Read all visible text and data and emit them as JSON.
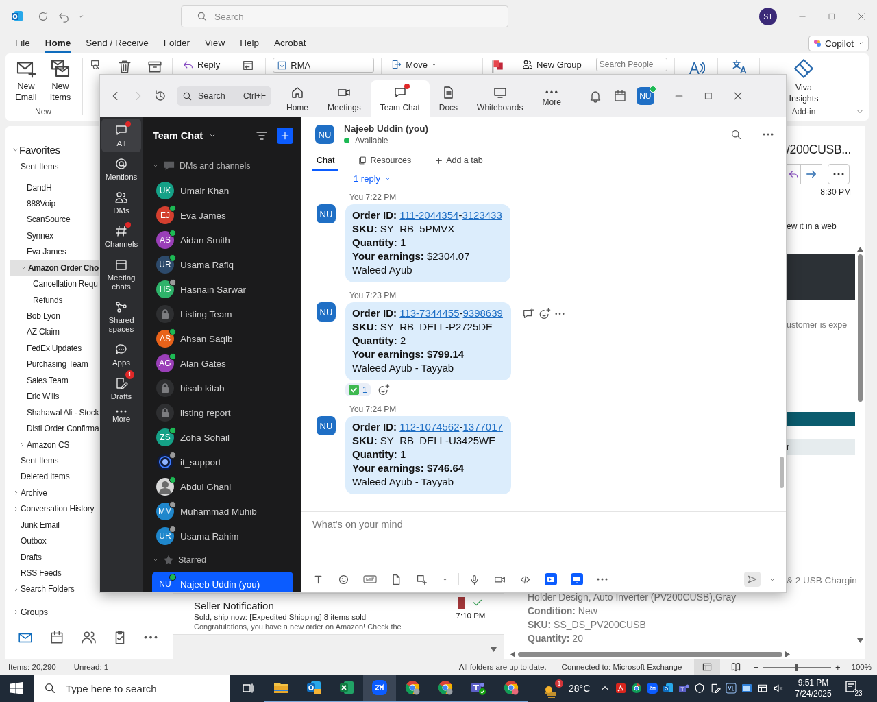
{
  "outlook": {
    "search_placeholder": "Search",
    "account_initials": "ST",
    "menu_tabs": [
      {
        "label": "File",
        "selected": false
      },
      {
        "label": "Home",
        "selected": true
      },
      {
        "label": "Send / Receive",
        "selected": false
      },
      {
        "label": "Folder",
        "selected": false
      },
      {
        "label": "View",
        "selected": false
      },
      {
        "label": "Help",
        "selected": false
      },
      {
        "label": "Acrobat",
        "selected": false
      }
    ],
    "copilot": "Copilot",
    "ribbon": {
      "new_email": "New Email",
      "new_items": "New Items",
      "new_group_label": "New",
      "reply": "Reply",
      "quick_step": "RMA",
      "move": "Move",
      "new_group": "New Group",
      "search_people_placeholder": "Search People",
      "viva": "Viva Insights",
      "addin_label": "Add-in"
    },
    "favorites": {
      "label": "Favorites",
      "expanded": true,
      "items": [
        {
          "label": "Sent Items",
          "selected": false
        }
      ]
    },
    "inbox_folders": [
      {
        "label": "DandH",
        "selected": false
      },
      {
        "label": "888Voip",
        "selected": false
      },
      {
        "label": "ScanSource",
        "selected": false
      },
      {
        "label": "Synnex",
        "selected": false
      },
      {
        "label": "Eva James",
        "selected": false
      },
      {
        "label": "Amazon Order Cho",
        "selected": true,
        "expanded": true,
        "children": [
          {
            "label": "Cancellation Requ",
            "selected": false
          },
          {
            "label": "Refunds",
            "selected": false
          }
        ]
      },
      {
        "label": "Bob Lyon",
        "selected": false
      },
      {
        "label": "AZ Claim",
        "selected": false
      },
      {
        "label": "FedEx Updates",
        "selected": false
      },
      {
        "label": "Purchasing Team",
        "selected": false
      },
      {
        "label": "Sales Team",
        "selected": false
      },
      {
        "label": "Eric Wills",
        "selected": false
      },
      {
        "label": "Shahawal Ali - Stock",
        "selected": false
      },
      {
        "label": "Disti Order Confirma",
        "selected": false
      },
      {
        "label": "Amazon CS",
        "selected": false,
        "expanded": false
      }
    ],
    "mailbox_folders": [
      {
        "label": "Sent Items",
        "selected": false
      },
      {
        "label": "Deleted Items",
        "selected": false
      },
      {
        "label": "Archive",
        "selected": false,
        "expanded": false
      },
      {
        "label": "Conversation History",
        "selected": false,
        "expanded": false
      },
      {
        "label": "Junk Email",
        "selected": false
      },
      {
        "label": "Outbox",
        "selected": false
      },
      {
        "label": "Drafts",
        "selected": false
      },
      {
        "label": "RSS Feeds",
        "selected": false
      },
      {
        "label": "Search Folders",
        "selected": false,
        "expanded": false
      }
    ],
    "groups": {
      "label": "Groups",
      "expanded": false
    },
    "nav": [
      {
        "selected": true
      },
      {
        "selected": false
      },
      {
        "selected": false
      },
      {
        "selected": false
      },
      {
        "selected": false
      }
    ],
    "message": {
      "sender": "Seller Notification",
      "subject": "Sold, ship now: [Expedited Shipping] 8 items sold",
      "preview": "Congratulations, you have a new order on Amazon! Check the",
      "time": "7:10 PM",
      "color": "#a4373a",
      "replied": true
    },
    "reading": {
      "subject": "/200CUSB...",
      "time": "8:30 PM",
      "fragment_1": "ew it in a web",
      "fragment_2": "ustomer is expe",
      "fragment_3": "r",
      "fragment_4": "& 2 USB Chargin",
      "lines": [
        {
          "kind": "plain",
          "text": "Holder Design, Auto Inverter (PV200CUSB),Gray"
        },
        {
          "kind": "field",
          "label": "Condition:",
          "value": "New"
        },
        {
          "kind": "field",
          "label": "SKU:",
          "value": "SS_DS_PV200CUSB"
        },
        {
          "kind": "field",
          "label": "Quantity:",
          "value": "20"
        }
      ]
    },
    "status": {
      "items": "Items: 20,290",
      "unread": "Unread: 1",
      "sync": "All folders are up to date.",
      "connection": "Connected to: Microsoft Exchange",
      "zoom_out": "−",
      "zoom_in": "+",
      "zoom": "100%",
      "level": 0.5
    }
  },
  "zoom_app": {
    "search": "Search",
    "shortcut": "Ctrl+F",
    "initials": "NU",
    "online": true,
    "tabs": [
      {
        "label": "Home",
        "selected": false,
        "dot": false
      },
      {
        "label": "Meetings",
        "selected": false,
        "dot": false
      },
      {
        "label": "Team Chat",
        "selected": true,
        "dot": true
      },
      {
        "label": "Docs",
        "selected": false,
        "dot": false
      },
      {
        "label": "Whiteboards",
        "selected": false,
        "dot": false
      },
      {
        "label": "More",
        "selected": false,
        "dot": false
      }
    ],
    "rail": [
      {
        "label": "All",
        "selected": true,
        "dot": true
      },
      {
        "label": "Mentions",
        "selected": false,
        "dot": false
      },
      {
        "label": "DMs",
        "selected": false,
        "dot": false
      },
      {
        "label": "Channels",
        "selected": false,
        "dot": true
      },
      {
        "label": "Meeting chats",
        "selected": false,
        "dot": false
      },
      {
        "label": "Shared spaces",
        "selected": false,
        "dot": false
      },
      {
        "label": "Apps",
        "selected": false,
        "dot": false
      },
      {
        "label": "Drafts",
        "selected": false,
        "dot": false,
        "count": "1"
      },
      {
        "label": "More",
        "selected": false,
        "dot": false
      }
    ],
    "list_title": "Team Chat",
    "sections": [
      {
        "label": "DMs and channels",
        "expanded": true,
        "items": [
          {
            "name": "Umair Khan",
            "kind": "initials",
            "initials": "UK",
            "color": "#15a187",
            "selected": false
          },
          {
            "name": "Eva James",
            "kind": "initials",
            "initials": "EJ",
            "color": "#d43f2f",
            "online": true,
            "selected": false
          },
          {
            "name": "Aidan Smith",
            "kind": "initials",
            "initials": "AS",
            "color": "#9a3fb8",
            "online": true,
            "selected": false
          },
          {
            "name": "Usama Rafiq",
            "kind": "initials",
            "initials": "UR",
            "color": "#2d4a6b",
            "online": true,
            "selected": false
          },
          {
            "name": "Hasnain Sarwar",
            "kind": "initials",
            "initials": "HS",
            "color": "#2eb36a",
            "online": false,
            "selected": false
          },
          {
            "name": "Listing Team",
            "kind": "locked",
            "selected": false
          },
          {
            "name": "Ahsan Saqib",
            "kind": "initials",
            "initials": "AS",
            "color": "#e8621a",
            "online": true,
            "selected": false
          },
          {
            "name": "Alan Gates",
            "kind": "initials",
            "initials": "AG",
            "color": "#9a3fb8",
            "online": true,
            "selected": false
          },
          {
            "name": "hisab kitab",
            "kind": "locked",
            "selected": false
          },
          {
            "name": "listing report",
            "kind": "locked",
            "selected": false
          },
          {
            "name": "Zoha Sohail",
            "kind": "initials",
            "initials": "ZS",
            "color": "#15a187",
            "online": true,
            "selected": false
          },
          {
            "name": "it_support",
            "kind": "logo",
            "online": false,
            "selected": false
          },
          {
            "name": "Abdul Ghani",
            "kind": "photo",
            "online": true,
            "selected": false
          },
          {
            "name": "Muhammad Muhib",
            "kind": "initials",
            "initials": "MM",
            "color": "#1f87cc",
            "online": false,
            "selected": false
          },
          {
            "name": "Usama Rahim",
            "kind": "initials",
            "initials": "UR",
            "color": "#1f87cc",
            "online": false,
            "selected": false
          }
        ]
      },
      {
        "label": "Starred",
        "expanded": true,
        "items": [
          {
            "name": "Najeeb Uddin (you)",
            "kind": "initials",
            "initials": "NU",
            "color": "#0b5cff",
            "online": true,
            "selected": true
          }
        ]
      }
    ],
    "chat": {
      "name": "Najeeb Uddin (you)",
      "initials": "NU",
      "status": "Available",
      "online": true,
      "tabs": [
        {
          "label": "Chat",
          "selected": true
        },
        {
          "label": "Resources",
          "selected": false
        },
        {
          "label": "Add a tab",
          "selected": false
        }
      ],
      "thread_reply": "1 reply",
      "messages": [
        {
          "sender": "You",
          "time": "7:22 PM",
          "initials": "NU",
          "hovered": false,
          "lines": [
            {
              "kind": "order",
              "label": "Order ID:",
              "links": [
                "111-2044354",
                "3123433"
              ],
              "separator": "-"
            },
            {
              "kind": "field",
              "label": "SKU:",
              "value": "SY_RB_5PMVX",
              "bold": false
            },
            {
              "kind": "field",
              "label": "Quantity:",
              "value": "1",
              "bold": false
            },
            {
              "kind": "field",
              "label": "Your earnings:",
              "value": "$2304.07",
              "bold": false
            },
            {
              "kind": "plain",
              "text": "Waleed Ayub"
            }
          ]
        },
        {
          "sender": "You",
          "time": "7:23 PM",
          "initials": "NU",
          "hovered": true,
          "lines": [
            {
              "kind": "order",
              "label": "Order ID:",
              "links": [
                "113-7344455",
                "9398639"
              ],
              "separator": "-"
            },
            {
              "kind": "field",
              "label": "SKU:",
              "value": "SY_RB_DELL-P2725DE",
              "bold": false
            },
            {
              "kind": "field",
              "label": "Quantity:",
              "value": "2",
              "bold": false
            },
            {
              "kind": "field",
              "label": "Your earnings:",
              "value": "$799.14",
              "bold": true
            },
            {
              "kind": "plain",
              "text": "Waleed Ayub - Tayyab"
            }
          ],
          "reactions": [
            {
              "count": "1"
            }
          ]
        },
        {
          "sender": "You",
          "time": "7:24 PM",
          "initials": "NU",
          "hovered": false,
          "lines": [
            {
              "kind": "order",
              "label": "Order ID:",
              "links": [
                "112-1074562",
                "1377017"
              ],
              "separator": "-"
            },
            {
              "kind": "field",
              "label": "SKU:",
              "value": "SY_RB_DELL-U3425WE",
              "bold": false
            },
            {
              "kind": "field",
              "label": "Quantity:",
              "value": "1",
              "bold": false
            },
            {
              "kind": "field",
              "label": "Your earnings:",
              "value": "$746.64",
              "bold": true
            },
            {
              "kind": "plain",
              "text": "Waleed Ayub - Tayyab"
            }
          ]
        }
      ],
      "composer_placeholder": "What's on your mind"
    }
  },
  "taskbar": {
    "search_placeholder": "Type here to search",
    "apps": [
      {
        "selected": false
      },
      {
        "selected": false
      },
      {
        "selected": false
      },
      {
        "selected": true
      },
      {
        "selected": false
      },
      {
        "selected": false
      },
      {
        "selected": false
      },
      {
        "selected": false
      }
    ],
    "weather_badge": "1",
    "temperature": "28°C",
    "time": "9:51 PM",
    "date": "7/24/2025",
    "notifications": "23"
  }
}
